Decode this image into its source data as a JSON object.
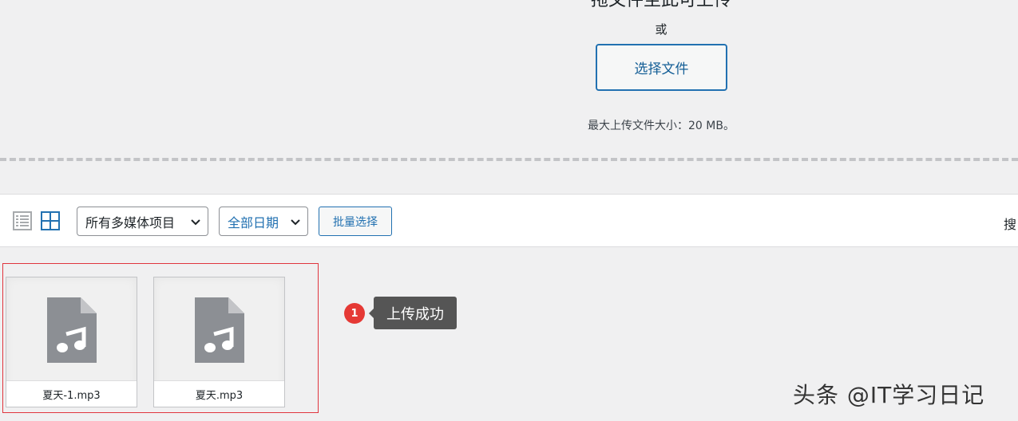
{
  "uploader": {
    "drop_title": "拖文件至此可上传",
    "or_text": "或",
    "select_files_label": "选择文件",
    "max_size_text": "最大上传文件大小：20 MB。"
  },
  "toolbar": {
    "view_list_icon": "list-view-icon",
    "view_grid_icon": "grid-view-icon",
    "type_filter_value": "所有多媒体项目",
    "date_filter_value": "全部日期",
    "bulk_select_label": "批量选择",
    "search_label": "搜"
  },
  "attachments": [
    {
      "filename": "夏天-1.mp3",
      "icon": "audio-file-icon"
    },
    {
      "filename": "夏天.mp3",
      "icon": "audio-file-icon"
    }
  ],
  "annotation": {
    "badge_number": "1",
    "tooltip_text": "上传成功"
  },
  "watermark": "头条 @IT学习日记",
  "colors": {
    "accent": "#2271b1",
    "highlight_border": "#e0353e",
    "badge": "#e53935",
    "tooltip_bg": "#555555"
  }
}
